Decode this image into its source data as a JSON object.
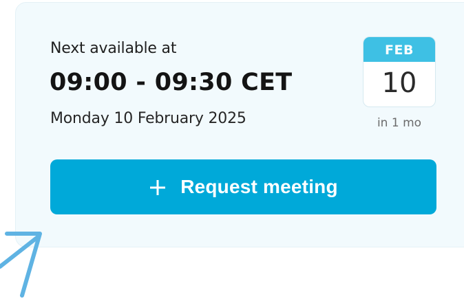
{
  "availability": {
    "label": "Next available at",
    "time_range": "09:00 - 09:30 CET",
    "date": "Monday 10 February 2025"
  },
  "calendar_badge": {
    "month": "FEB",
    "day": "10",
    "relative": "in 1 mo",
    "header_color": "#3ec0e4"
  },
  "actions": {
    "request_label": "Request meeting",
    "request_icon": "plus-icon",
    "button_color": "#00a9d9"
  },
  "annotation": {
    "icon": "arrow-icon",
    "color": "#5fb3e3"
  }
}
